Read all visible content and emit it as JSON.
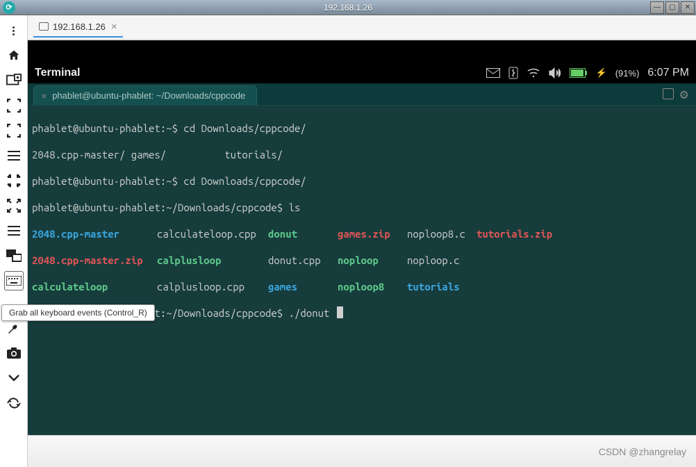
{
  "window": {
    "title": "192.168.1.26",
    "minimize_tip": "Minimize",
    "maximize_tip": "Maximize",
    "close_tip": "Close"
  },
  "tab": {
    "label": "192.168.1.26",
    "close": "×"
  },
  "tooltip": {
    "text": "Grab all keyboard events (Control_R)"
  },
  "statusbar": {
    "title": "Terminal",
    "battery": "(91%)",
    "time": "6:07 PM"
  },
  "term_tab": {
    "label": "phablet@ubuntu-phablet: ~/Downloads/cppcode",
    "close": "×"
  },
  "terminal": {
    "line1_prompt": "phablet@ubuntu-phablet:~$",
    "line1_cmd": " cd Downloads/cppcode/",
    "line2_a": "2048.cpp-master/",
    "line2_b": " games/          tutorials/",
    "line3_prompt": "phablet@ubuntu-phablet:~$",
    "line3_cmd": " cd Downloads/cppcode/",
    "line4_prompt": "phablet@ubuntu-phablet:~/Downloads/cppcode$",
    "line4_cmd": " ls",
    "ls": {
      "r1c1": "2048.cpp-master",
      "r1c2": "calculateloop.cpp",
      "r1c3": "donut",
      "r1c4": "games.zip",
      "r1c5": "noploop8.c",
      "r1c6": "tutorials.zip",
      "r2c1": "2048.cpp-master.zip",
      "r2c2": "calplusloop",
      "r2c3": "donut.cpp",
      "r2c4": "noploop",
      "r2c5": "noploop.c",
      "r3c1": "calculateloop",
      "r3c2": "calplusloop.cpp",
      "r3c3": "games",
      "r3c4": "noploop8",
      "r3c5": "tutorials"
    },
    "line8_prompt": "phablet@ubuntu-phablet:~/Downloads/cppcode$",
    "line8_cmd": " ./donut "
  },
  "footer": {
    "watermark": "CSDN @zhangrelay"
  }
}
